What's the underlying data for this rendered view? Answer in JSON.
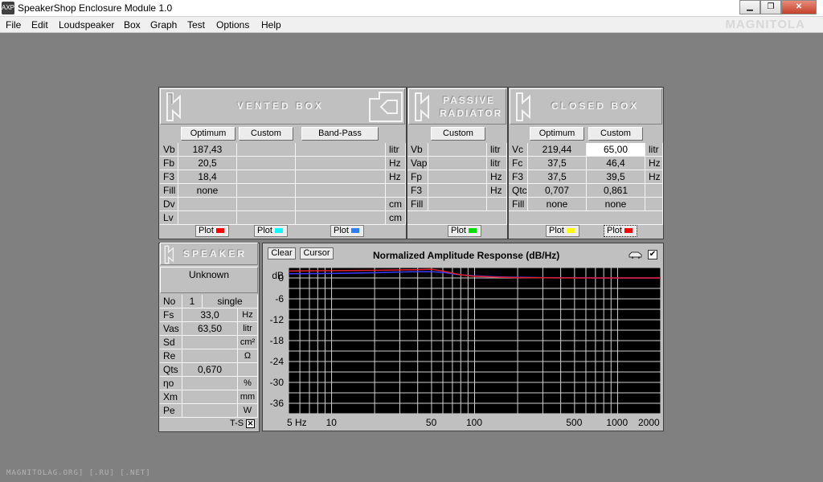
{
  "window": {
    "title": "SpeakerShop Enclosure Module 1.0",
    "app_icon_text": "AXP"
  },
  "menu": [
    "File",
    "Edit",
    "Loudspeaker",
    "Box",
    "Graph",
    "Test",
    "Options",
    "Help"
  ],
  "watermarks": {
    "top": "MAGNITOLA",
    "bottom": "MAGNITOLAG.ORG] [.RU] [.NET]"
  },
  "vented": {
    "title": "VENTED BOX",
    "buttons": [
      "Optimum",
      "Custom",
      "Band-Pass"
    ],
    "labels": [
      "Vb",
      "Fb",
      "F3",
      "Fill",
      "Dv",
      "Lv"
    ],
    "units": [
      "litr",
      "Hz",
      "Hz",
      "",
      "cm",
      "cm"
    ],
    "optimum": [
      "187,43",
      "20,5",
      "18,4",
      "none",
      "",
      ""
    ],
    "plot": "Plot"
  },
  "passive": {
    "title_line1": "PASSIVE",
    "title_line2": "RADIATOR",
    "button": "Custom",
    "labels": [
      "Vb",
      "Vap",
      "Fp",
      "F3",
      "Fill"
    ],
    "units": [
      "litr",
      "litr",
      "Hz",
      "Hz",
      ""
    ],
    "plot": "Plot"
  },
  "closed": {
    "title": "CLOSED BOX",
    "buttons": [
      "Optimum",
      "Custom"
    ],
    "labels": [
      "Vc",
      "Fc",
      "F3",
      "Qtc",
      "Fill"
    ],
    "units": [
      "litr",
      "Hz",
      "Hz",
      "",
      ""
    ],
    "optimum": [
      "219,44",
      "37,5",
      "37,5",
      "0,707",
      "none"
    ],
    "custom": [
      "65,00",
      "46,4",
      "39,5",
      "0,861",
      "none"
    ],
    "plot": "Plot"
  },
  "speaker": {
    "title": "SPEAKER",
    "name": "Unknown",
    "no_label": "No",
    "no_value": "1",
    "mode": "single",
    "rows": [
      {
        "label": "Fs",
        "value": "33,0",
        "unit": "Hz"
      },
      {
        "label": "Vas",
        "value": "63,50",
        "unit": "litr"
      },
      {
        "label": "Sd",
        "value": "",
        "unit": "cm²"
      },
      {
        "label": "Re",
        "value": "",
        "unit": "Ω"
      },
      {
        "label": "Qts",
        "value": "0,670",
        "unit": ""
      },
      {
        "label": "ηo",
        "value": "",
        "unit": "%"
      },
      {
        "label": "Xm",
        "value": "",
        "unit": "mm"
      },
      {
        "label": "Pe",
        "value": "",
        "unit": "W"
      }
    ],
    "ts_label": "T-S",
    "ts_checked": "✕"
  },
  "graph": {
    "clear": "Clear",
    "cursor": "Cursor",
    "checkbox": "✔"
  },
  "chart_data": {
    "type": "line",
    "title": "Normalized Amplitude Response (dB/Hz)",
    "ylabel": "dB",
    "xlabel": "",
    "x_scale": "log",
    "xlim": [
      5,
      2000
    ],
    "ylim": [
      -39,
      3
    ],
    "x_ticks": [
      {
        "v": 5,
        "label": "5 Hz"
      },
      {
        "v": 10,
        "label": "10"
      },
      {
        "v": 50,
        "label": "50"
      },
      {
        "v": 100,
        "label": "100"
      },
      {
        "v": 500,
        "label": "500"
      },
      {
        "v": 1000,
        "label": "1000"
      },
      {
        "v": 2000,
        "label": "2000"
      }
    ],
    "y_ticks": [
      "0",
      "-6",
      "-12",
      "-18",
      "-24",
      "-30",
      "-36"
    ],
    "y_tick_values": [
      0,
      -6,
      -12,
      -18,
      -24,
      -30,
      -36
    ],
    "grid": true,
    "background": "#000000",
    "series": [
      {
        "color": "#3a3aff",
        "x": [
          5,
          10,
          20,
          30,
          40,
          50,
          60,
          70,
          80,
          100,
          150,
          200,
          300,
          500,
          1000,
          2000
        ],
        "y": [
          1.2,
          1.3,
          1.5,
          1.7,
          1.8,
          1.8,
          1.6,
          1.2,
          0.9,
          0.6,
          0.3,
          0.2,
          0.1,
          0.05,
          0,
          0
        ]
      },
      {
        "color": "#e0202a",
        "x": [
          5,
          10,
          20,
          30,
          40,
          50,
          60,
          70,
          80,
          100,
          150,
          200,
          300,
          500,
          1000,
          2000
        ],
        "y": [
          2.0,
          2.1,
          2.2,
          2.3,
          2.4,
          2.5,
          2.0,
          1.4,
          0.9,
          0.5,
          0.2,
          0.1,
          0.05,
          0,
          0,
          0
        ]
      }
    ]
  },
  "colors": {
    "plot_red": "#ff0000",
    "plot_cyan": "#00ffff",
    "plot_blue": "#2a7fff",
    "plot_green": "#00e000",
    "plot_yellow": "#ffff00",
    "plot_red2": "#ff0000"
  }
}
